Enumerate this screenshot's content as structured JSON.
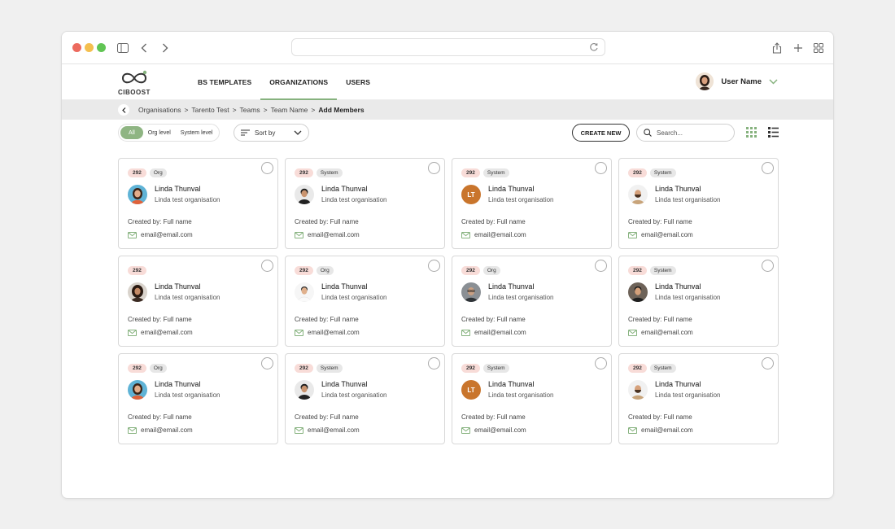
{
  "brand": {
    "logo_text": "CIBOOST",
    "accent": "#86b27e"
  },
  "nav": {
    "items": [
      {
        "label": "BS TEMPLATES",
        "active": false
      },
      {
        "label": "ORGANIZATIONS",
        "active": true
      },
      {
        "label": "USERS",
        "active": false
      }
    ]
  },
  "user": {
    "name": "User Name"
  },
  "breadcrumb": [
    "Organisations",
    "Tarento Test",
    "Teams",
    "Team Name",
    "Add Members"
  ],
  "filters": {
    "options": [
      {
        "label": "All",
        "active": true
      },
      {
        "label": "Org level",
        "active": false
      },
      {
        "label": "System level",
        "active": false
      }
    ],
    "sort_label": "Sort by"
  },
  "actions": {
    "create_label": "CREATE NEW",
    "search_placeholder": "Search..."
  },
  "cards": [
    {
      "count": "292",
      "type": "Org",
      "name": "Linda Thunval",
      "org": "Linda test organisation",
      "created": "Created by: Full name",
      "email": "email@email.com",
      "avatar": "woman-blue"
    },
    {
      "count": "292",
      "type": "System",
      "name": "Linda Thunval",
      "org": "Linda test organisation",
      "created": "Created by: Full name",
      "email": "email@email.com",
      "avatar": "man-dark"
    },
    {
      "count": "292",
      "type": "System",
      "name": "Linda Thunval",
      "org": "Linda test organisation",
      "created": "Created by: Full name",
      "email": "email@email.com",
      "avatar": "initials",
      "initials": "LT"
    },
    {
      "count": "292",
      "type": "System",
      "name": "Linda Thunval",
      "org": "Linda test organisation",
      "created": "Created by: Full name",
      "email": "email@email.com",
      "avatar": "man-beard"
    },
    {
      "count": "292",
      "type": "",
      "name": "Linda Thunval",
      "org": "Linda test organisation",
      "created": "Created by: Full name",
      "email": "email@email.com",
      "avatar": "woman-curly"
    },
    {
      "count": "292",
      "type": "Org",
      "name": "Linda Thunval",
      "org": "Linda test organisation",
      "created": "Created by: Full name",
      "email": "email@email.com",
      "avatar": "man-white"
    },
    {
      "count": "292",
      "type": "Org",
      "name": "Linda Thunval",
      "org": "Linda test organisation",
      "created": "Created by: Full name",
      "email": "email@email.com",
      "avatar": "man-glasses"
    },
    {
      "count": "292",
      "type": "System",
      "name": "Linda Thunval",
      "org": "Linda test organisation",
      "created": "Created by: Full name",
      "email": "email@email.com",
      "avatar": "man-smile"
    },
    {
      "count": "292",
      "type": "Org",
      "name": "Linda Thunval",
      "org": "Linda test organisation",
      "created": "Created by: Full name",
      "email": "email@email.com",
      "avatar": "woman-blue"
    },
    {
      "count": "292",
      "type": "System",
      "name": "Linda Thunval",
      "org": "Linda test organisation",
      "created": "Created by: Full name",
      "email": "email@email.com",
      "avatar": "man-dark"
    },
    {
      "count": "292",
      "type": "System",
      "name": "Linda Thunval",
      "org": "Linda test organisation",
      "created": "Created by: Full name",
      "email": "email@email.com",
      "avatar": "initials",
      "initials": "LT"
    },
    {
      "count": "292",
      "type": "System",
      "name": "Linda Thunval",
      "org": "Linda test organisation",
      "created": "Created by: Full name",
      "email": "email@email.com",
      "avatar": "man-beard"
    }
  ]
}
